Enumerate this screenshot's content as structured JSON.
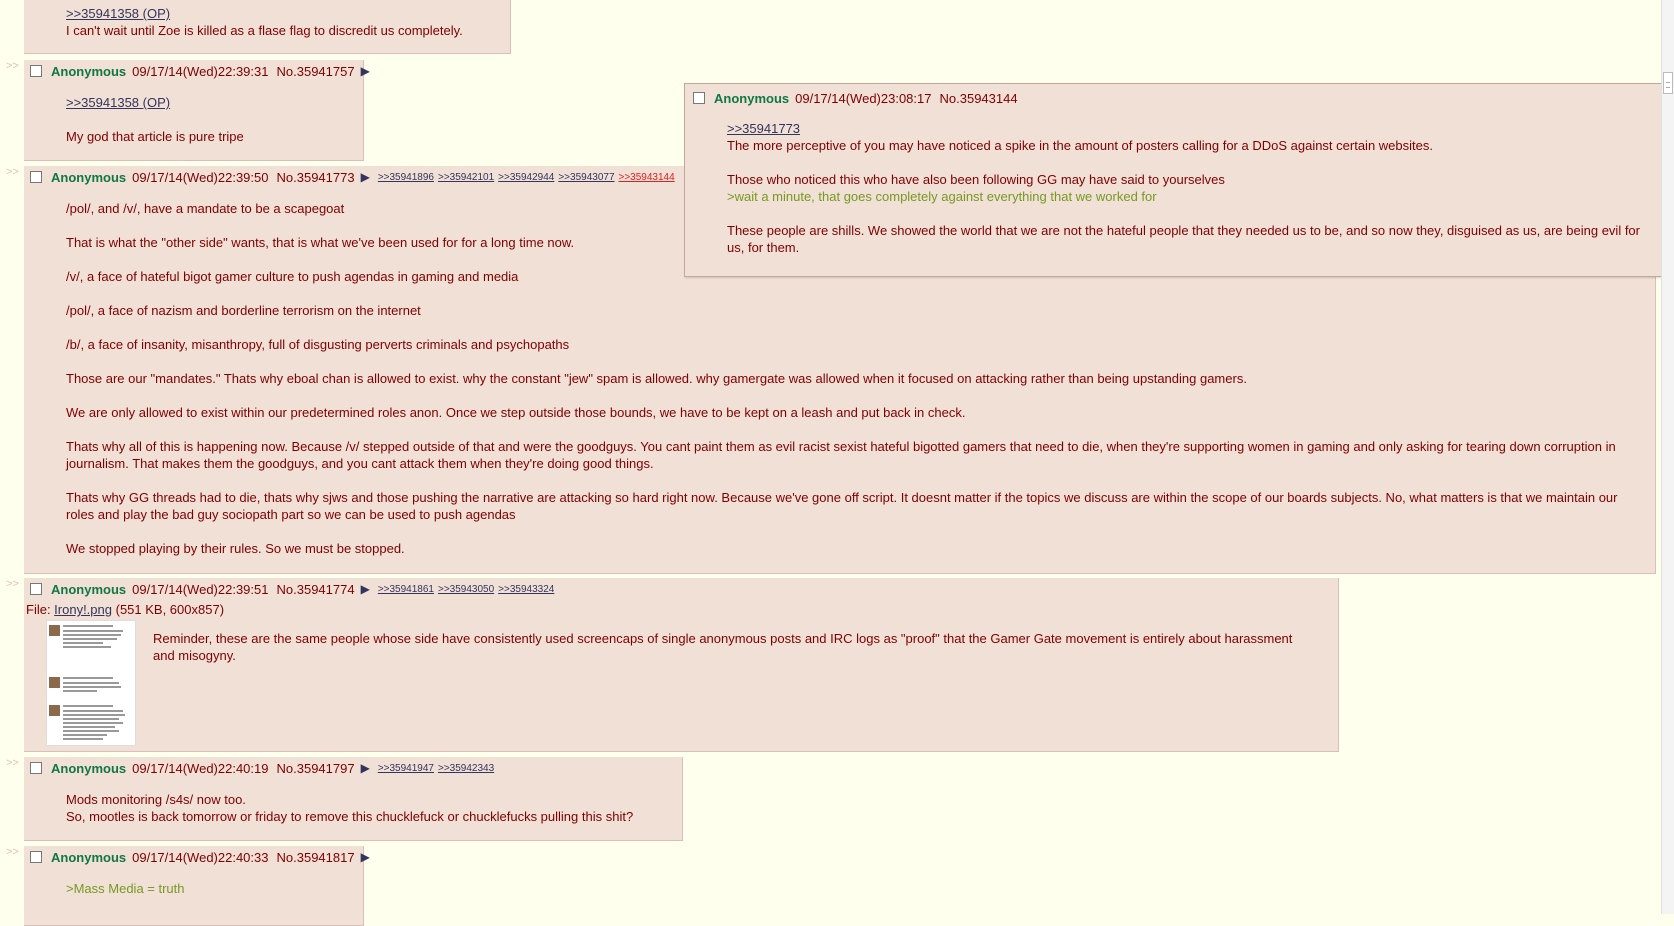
{
  "post0": {
    "backlink": ">>35941358 (OP)",
    "text": "I can't wait until Zoe is killed as a flase flag to discredit us completely."
  },
  "post1": {
    "name": "Anonymous",
    "datetime": "09/17/14(Wed)22:39:31",
    "number": "No.35941757",
    "quotelink": ">>35941358 (OP)",
    "text": "My god that article is pure tripe"
  },
  "post2": {
    "name": "Anonymous",
    "datetime": "09/17/14(Wed)22:39:50",
    "number": "No.35941773",
    "backlinks": [
      ">>35941896",
      ">>35942101",
      ">>35942944",
      ">>35943077",
      ">>35943144"
    ],
    "paragraphs": [
      "/pol/, and /v/, have a mandate to be a scapegoat",
      "That is what the \"other side\" wants, that is what we've been used for for a long time now.",
      "/v/, a face of hateful bigot gamer culture to push agendas in gaming and media",
      "/pol/, a face of nazism and borderline terrorism on the internet",
      "/b/, a face of insanity, misanthropy, full of disgusting perverts criminals and psychopaths",
      "Those are our \"mandates.\" Thats why eboal chan is allowed to exist. why the constant \"jew\" spam is allowed. why gamergate was allowed when it focused on attacking rather than being upstanding gamers.",
      "We are only allowed to exist within our predetermined roles anon. Once we step outside those bounds, we have to be kept on a leash and put back in check.",
      "Thats why all of this is happening now. Because /v/ stepped outside of that and were the goodguys. You cant paint them as evil racist sexist hateful bigotted gamers that need to die, when they're supporting women in gaming and only asking for tearing down corruption in journalism. That makes them the goodguys, and you cant attack them when they're doing good things.",
      "Thats why GG threads had to die, thats why sjws and those pushing the narrative are attacking so hard right now. Because we've gone off script. It doesnt matter if the topics we discuss are within the scope of our boards subjects. No, what matters is that we maintain our roles and play the bad guy sociopath part so we can be used to push agendas",
      "We stopped playing by their rules. So we must be stopped."
    ]
  },
  "post3": {
    "name": "Anonymous",
    "datetime": "09/17/14(Wed)22:39:51",
    "number": "No.35941774",
    "backlinks": [
      ">>35941861",
      ">>35943050",
      ">>35943324"
    ],
    "file_prefix": "File: ",
    "file_name": "Irony!.png",
    "file_info": " (551 KB, 600x857)",
    "text": "Reminder, these are the same people whose side have consistently used screencaps of single anonymous posts and IRC logs as \"proof\" that the Gamer Gate movement is entirely about harassment and misogyny."
  },
  "post4": {
    "name": "Anonymous",
    "datetime": "09/17/14(Wed)22:40:19",
    "number": "No.35941797",
    "backlinks": [
      ">>35941947",
      ">>35942343"
    ],
    "lines": [
      "Mods monitoring /s4s/ now too.",
      "So, mootles is back tomorrow or friday to remove this chucklefuck or chucklefucks pulling this shit?"
    ]
  },
  "post5": {
    "name": "Anonymous",
    "datetime": "09/17/14(Wed)22:40:33",
    "number": "No.35941817",
    "greentext": ">Mass Media = truth"
  },
  "preview": {
    "name": "Anonymous",
    "datetime": "09/17/14(Wed)23:08:17",
    "number": "No.35943144",
    "quotelink": ">>35941773",
    "line1": "The more perceptive of you may have noticed a spike in the amount of posters calling for a DDoS against certain websites.",
    "line2": "Those who noticed this who have also been following GG may have said to yourselves",
    "greentext": ">wait a minute, that goes completely against everything that we worked for",
    "line3": "These people are shills. We showed the world that we are not the hateful people that they needed us to be, and so now they, disguised as us, are being evil for us, for them."
  },
  "ui": {
    "arrows": ">>",
    "play_glyph": "▶"
  },
  "colors": {
    "background": "#ffffee",
    "post_bg": "#f0e0d6",
    "name": "#117743",
    "greentext": "#789922",
    "link": "#34345c"
  }
}
